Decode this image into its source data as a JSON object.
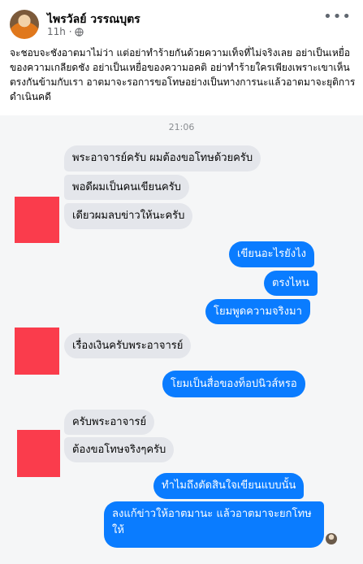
{
  "post": {
    "author": "ไพรวัลย์ วรรณบุตร",
    "time": "11h ·",
    "caption": "จะชอบจะชังอาตมาไม่ว่า แต่อย่าทำร้ายกันด้วยความเท็จที่ไม่จริงเลย อย่าเป็นเหยื่อของความเกลียดชัง อย่าเป็นเหยื่อของความอคติ อย่าทำร้ายใครเพียงเพราะเขาเห็นตรงกันข้ามกับเรา อาตมาจะรอการขอโทษอย่างเป็นทางการนะแล้วอาตมาจะยุติการดำเนินคดี",
    "more_label": "•••"
  },
  "chat": {
    "timestamp": "21:06",
    "messages": [
      {
        "dir": "in",
        "text": "พระอาจารย์ครับ ผมต้องขอโทษด้วยครับ"
      },
      {
        "dir": "in",
        "text": "พอดีผมเป็นคนเขียนครับ"
      },
      {
        "dir": "in",
        "text": "เดียวผมลบข่าวให้นะครับ"
      },
      {
        "dir": "out",
        "text": "เขียนอะไรยังไง"
      },
      {
        "dir": "out",
        "text": "ตรงไหน"
      },
      {
        "dir": "out",
        "text": "โยมพูดความจริงมา"
      },
      {
        "dir": "in",
        "text": "เรื่องเงินครับพระอาจารย์"
      },
      {
        "dir": "out",
        "text": "โยมเป็นสื่อของท็อปนิวส์หรอ"
      },
      {
        "dir": "in",
        "text": "ครับพระอาจารย์"
      },
      {
        "dir": "in",
        "text": "ต้องขอโทษจริงๆครับ"
      },
      {
        "dir": "out",
        "text": "ทำไมถึงตัดสินใจเขียนแบบนั้น"
      },
      {
        "dir": "out",
        "text": "ลงแก้ข่าวให้อาตมานะ แล้วอาตมาจะยกโทษให้"
      }
    ]
  },
  "colors": {
    "incoming_bubble": "#e4e6eb",
    "outgoing_bubble": "#0a7cff",
    "redaction": "#fa3c4c",
    "chat_background": "#f5f6f7"
  }
}
